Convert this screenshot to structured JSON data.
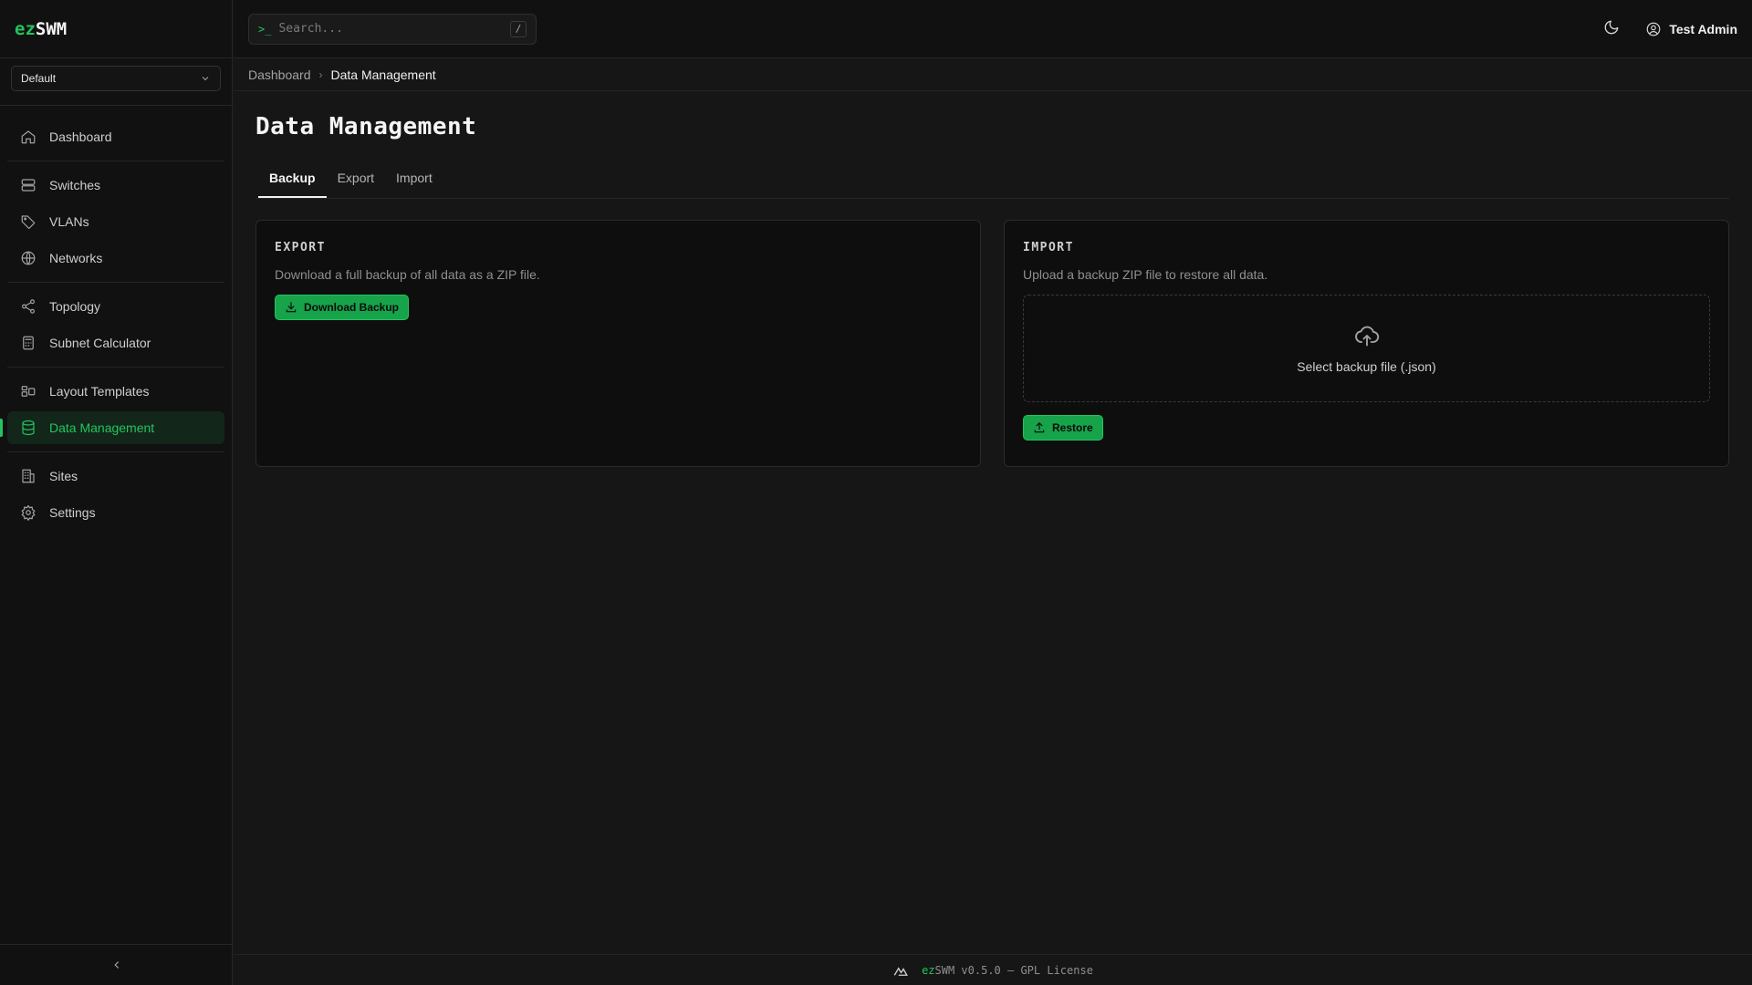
{
  "app": {
    "logo_prefix": "ez",
    "logo_suffix": "SWM"
  },
  "site_selector": {
    "value": "Default"
  },
  "sidebar": {
    "items": [
      {
        "label": "Dashboard",
        "icon": "home-icon"
      },
      {
        "label": "Switches",
        "icon": "server-icon"
      },
      {
        "label": "VLANs",
        "icon": "tag-icon"
      },
      {
        "label": "Networks",
        "icon": "globe-icon"
      },
      {
        "label": "Topology",
        "icon": "share-icon"
      },
      {
        "label": "Subnet Calculator",
        "icon": "calculator-icon"
      },
      {
        "label": "Layout Templates",
        "icon": "layout-icon"
      },
      {
        "label": "Data Management",
        "icon": "database-icon",
        "active": true
      },
      {
        "label": "Sites",
        "icon": "building-icon"
      },
      {
        "label": "Settings",
        "icon": "gear-icon"
      }
    ]
  },
  "header": {
    "search_prompt": ">_",
    "search_placeholder": "Search...",
    "search_shortcut": "/",
    "user_name": "Test Admin"
  },
  "breadcrumb": {
    "parent": "Dashboard",
    "current": "Data Management"
  },
  "page": {
    "title": "Data Management",
    "tabs": [
      "Backup",
      "Export",
      "Import"
    ],
    "active_tab": "Backup"
  },
  "export_card": {
    "title": "EXPORT",
    "description": "Download a full backup of all data as a ZIP file.",
    "button": "Download Backup"
  },
  "import_card": {
    "title": "IMPORT",
    "description": "Upload a backup ZIP file to restore all data.",
    "dropzone_label": "Select backup file (.json)",
    "button": "Restore"
  },
  "footer": {
    "brand_prefix": "ez",
    "text": "SWM v0.5.0 — GPL License"
  },
  "colors": {
    "accent": "#22c55e",
    "background": "#161616",
    "sidebar": "#111111"
  }
}
